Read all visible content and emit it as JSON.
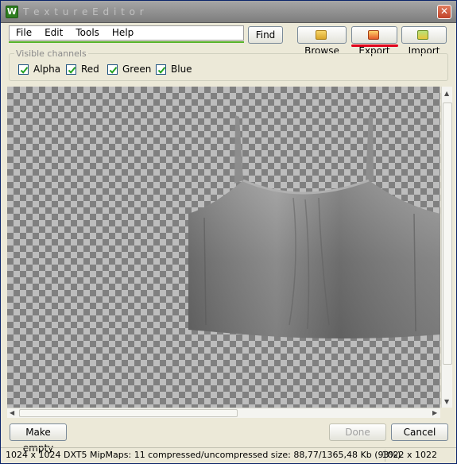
{
  "window": {
    "title": "T e x t u r e   E d i t o r",
    "app_icon_letter": "W",
    "close_glyph": "✕"
  },
  "menu": [
    {
      "label": "File"
    },
    {
      "label": "Edit"
    },
    {
      "label": "Tools"
    },
    {
      "label": "Help"
    }
  ],
  "toolbar": {
    "find_label": "Find",
    "browse_label": "Browse",
    "export_label": "Export",
    "import_label": "Import"
  },
  "channels": {
    "legend": "Visible channels",
    "items": [
      {
        "label": "Alpha",
        "checked": true
      },
      {
        "label": "Red",
        "checked": true
      },
      {
        "label": "Green",
        "checked": true
      },
      {
        "label": "Blue",
        "checked": true
      }
    ]
  },
  "footer": {
    "make_empty_label": "Make empty",
    "done_label": "Done",
    "cancel_label": "Cancel"
  },
  "status": {
    "info": "1024 x 1024 DXT5 MipMaps: 11 compressed/uncompressed size: 88,77/1365,48 Kb (93%)",
    "dimensions": "1022 x 1022"
  },
  "colors": {
    "highlight_underline": "#e0001b",
    "menu_accent": "#55b22a"
  }
}
